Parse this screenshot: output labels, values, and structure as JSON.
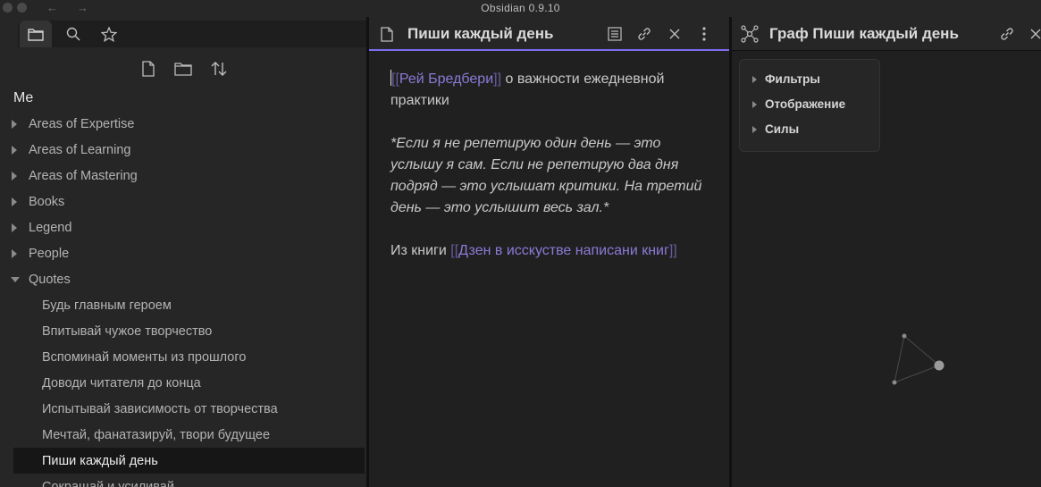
{
  "window": {
    "title": "Obsidian 0.9.10",
    "back_glyph": "←",
    "forward_glyph": "→"
  },
  "sidebar": {
    "tabs": [
      "folder-icon",
      "search-icon",
      "star-icon"
    ],
    "actions": [
      "new-note-icon",
      "new-folder-icon",
      "sort-icon"
    ],
    "vault_name": "Me",
    "tree": [
      {
        "label": "Areas of Expertise",
        "expanded": false
      },
      {
        "label": "Areas of Learning",
        "expanded": false
      },
      {
        "label": "Areas of Mastering",
        "expanded": false
      },
      {
        "label": "Books",
        "expanded": false
      },
      {
        "label": "Legend",
        "expanded": false
      },
      {
        "label": "People",
        "expanded": false
      },
      {
        "label": "Quotes",
        "expanded": true
      }
    ],
    "quotes_children": [
      "Будь главным героем",
      "Впитывай чужое творчество",
      "Вспоминай моменты из прошлого",
      "Доводи читателя до конца",
      "Испытывай зависимость от творчества",
      "Мечтай, фанатазируй, твори будущее",
      "Пиши каждый день",
      "Сокращай и усиливай"
    ],
    "selected_item": "Пиши каждый день"
  },
  "editor": {
    "title": "Пиши каждый день",
    "open_bracket": "[[",
    "close_bracket": "]]",
    "link_author": "Рей Бредбери",
    "line1_rest": " о важности ежедневной практики",
    "quote": "*Если я не репетирую один день — это услышу я сам. Если не репетирую два дня подряд — это услышат критики. На третий день — это услышит весь зал.*",
    "from_book_prefix": "Из книги ",
    "link_book": "Дзен в исскустве написани книг"
  },
  "graph": {
    "title": "Граф Пиши каждый день",
    "filters": [
      "Фильтры",
      "Отображение",
      "Силы"
    ]
  },
  "colors": {
    "accent": "#7f6df2",
    "link": "#8c7ad6",
    "background": "#202020",
    "sidebar": "#262626"
  }
}
